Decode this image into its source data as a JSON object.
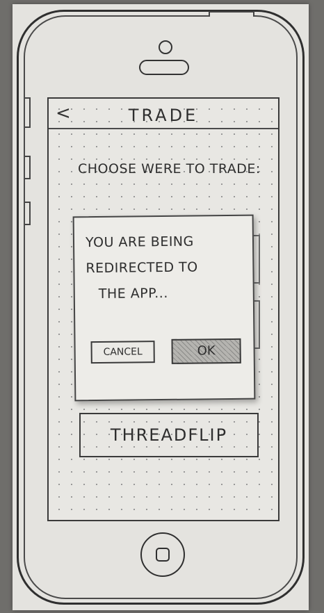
{
  "nav": {
    "back_icon": "chevron-left-icon",
    "back_glyph": "<",
    "title": "TRADE"
  },
  "main": {
    "prompt": "CHOOSE WERE TO TRADE:",
    "options": [
      {
        "label": "THREADFLIP"
      }
    ]
  },
  "dialog": {
    "message_lines": [
      "YOU ARE BEING",
      "REDIRECTED TO",
      "THE APP..."
    ],
    "cancel_label": "CANCEL",
    "ok_label": "OK"
  },
  "device": {
    "home_button_icon": "home-button-icon"
  }
}
